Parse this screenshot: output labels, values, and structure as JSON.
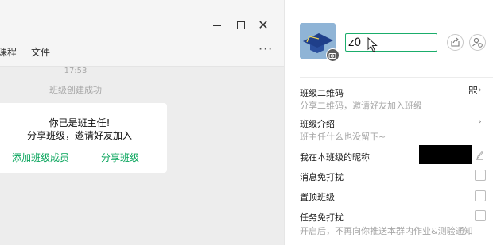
{
  "window": {
    "minimize_glyph": "",
    "maximize_glyph": "",
    "close_glyph": "✕"
  },
  "chat": {
    "tabs": [
      "课程",
      "文件"
    ],
    "more_glyph": "···",
    "time": "17:53",
    "system_message": "班级创建成功",
    "card": {
      "title": "你已是班主任!",
      "subtitle": "分享班级，邀请好友加入",
      "add_member_link": "添加班级成员",
      "share_link": "分享班级"
    }
  },
  "panel": {
    "name_input_value": "z0",
    "qrcode": {
      "title": "班级二维码",
      "subtitle": "分享二维码，邀请好友加入班级",
      "chevron": "›"
    },
    "intro": {
      "title": "班级介绍",
      "subtitle": "班主任什么也没留下~",
      "chevron": "›"
    },
    "nickname_label": "我在本班级的昵称",
    "mute_label": "消息免打扰",
    "pin_label": "置顶班级",
    "task_mute": {
      "title": "任务免打扰",
      "subtitle": "开启后，不再向你推送本群内作业&测验通知"
    },
    "checkboxes": {
      "mute": false,
      "pin": false,
      "task_mute": false
    }
  },
  "colors": {
    "accent_green": "#07a45b",
    "input_border": "#1aad6b",
    "chat_bg": "#ededed"
  },
  "icons": [
    "minimize-icon",
    "maximize-icon",
    "close-icon",
    "more-icon",
    "graduation-cap-icon",
    "camera-icon",
    "cursor-icon",
    "share-icon",
    "person-icon",
    "qrcode-icon",
    "chevron-right-icon",
    "pen-icon"
  ]
}
